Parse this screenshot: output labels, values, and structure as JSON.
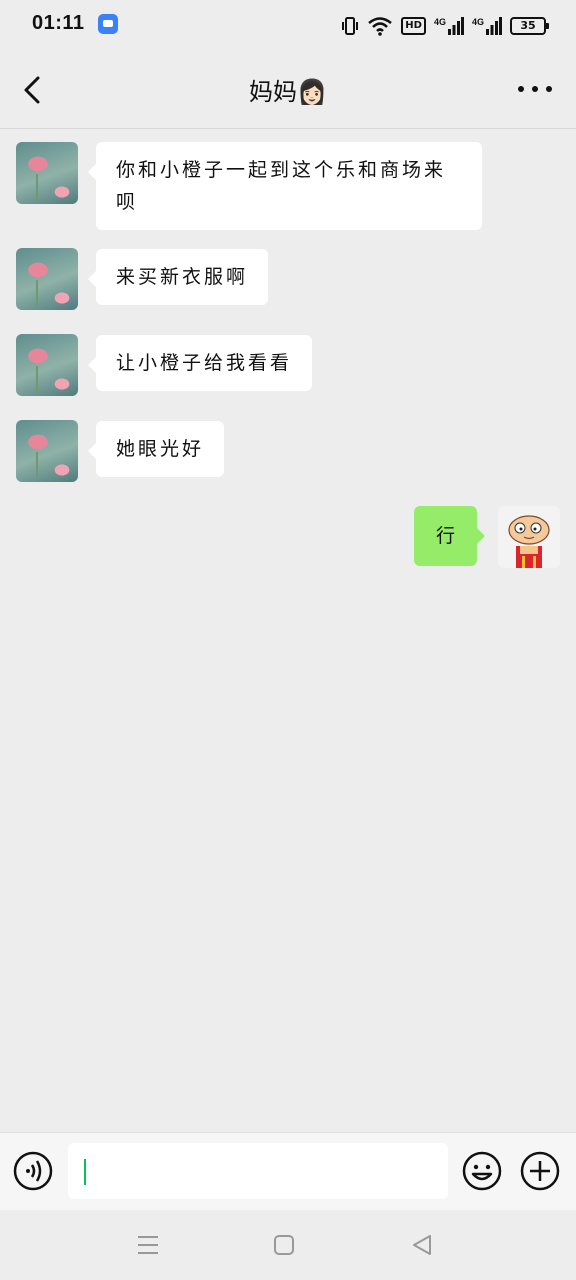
{
  "status_bar": {
    "time": "01:11",
    "network_1": "4G",
    "network_2": "4G",
    "hd_label": "HD",
    "battery": "35"
  },
  "header": {
    "title": "妈妈👩🏻"
  },
  "messages": [
    {
      "side": "left",
      "text": "你和小橙子一起到这个乐和商场来呗"
    },
    {
      "side": "left",
      "text": "来买新衣服啊"
    },
    {
      "side": "left",
      "text": "让小橙子给我看看"
    },
    {
      "side": "left",
      "text": "她眼光好"
    },
    {
      "side": "right",
      "text": "行"
    }
  ],
  "input": {
    "value": ""
  },
  "colors": {
    "background": "#ededed",
    "sent_bubble": "#95ec69",
    "received_bubble": "#ffffff",
    "caret": "#07c160"
  }
}
